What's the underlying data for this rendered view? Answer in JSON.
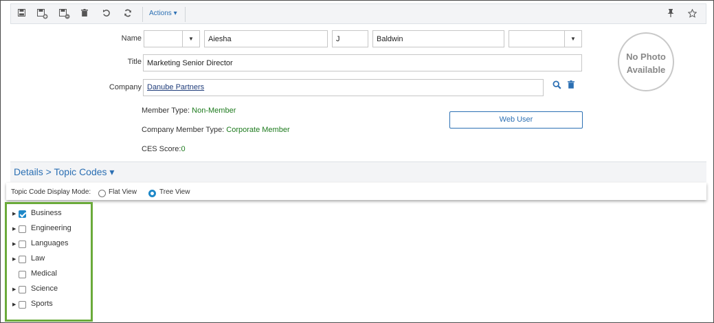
{
  "toolbar": {
    "actions_label": "Actions ▾",
    "icons": [
      "save-icon",
      "save-new-icon",
      "save-add-icon",
      "delete-icon",
      "undo-icon",
      "refresh-icon",
      "pin-icon",
      "star-icon"
    ]
  },
  "form": {
    "name_label": "Name",
    "prefix_value": "",
    "first_name": "Aiesha",
    "middle_initial": "J",
    "last_name": "Baldwin",
    "suffix_value": "",
    "title_label": "Title",
    "title_value": "Marketing Senior Director",
    "company_label": "Company",
    "company_value": "Danube Partners"
  },
  "info": {
    "member_type_label": "Member Type: ",
    "member_type_value": "Non-Member",
    "company_member_type_label": "Company Member Type: ",
    "company_member_type_value": "Corporate Member",
    "ces_score_label": "CES Score:",
    "ces_score_value": "0"
  },
  "web_user_label": "Web User",
  "photo": {
    "line1": "No Photo",
    "line2": "Available"
  },
  "details": {
    "title": "Details > Topic Codes ▾"
  },
  "display_mode": {
    "label": "Topic Code Display Mode:",
    "options": [
      {
        "label": "Flat View",
        "selected": false
      },
      {
        "label": "Tree View",
        "selected": true
      }
    ]
  },
  "topics": [
    {
      "label": "Business",
      "checked": true,
      "expandable": true
    },
    {
      "label": "Engineering",
      "checked": false,
      "expandable": true
    },
    {
      "label": "Languages",
      "checked": false,
      "expandable": true
    },
    {
      "label": "Law",
      "checked": false,
      "expandable": true
    },
    {
      "label": "Medical",
      "checked": false,
      "expandable": false
    },
    {
      "label": "Science",
      "checked": false,
      "expandable": true
    },
    {
      "label": "Sports",
      "checked": false,
      "expandable": true
    }
  ],
  "colors": {
    "accent": "#2b6fb3",
    "green_value": "#1d7a1d",
    "tree_border": "#6aaa3a"
  }
}
